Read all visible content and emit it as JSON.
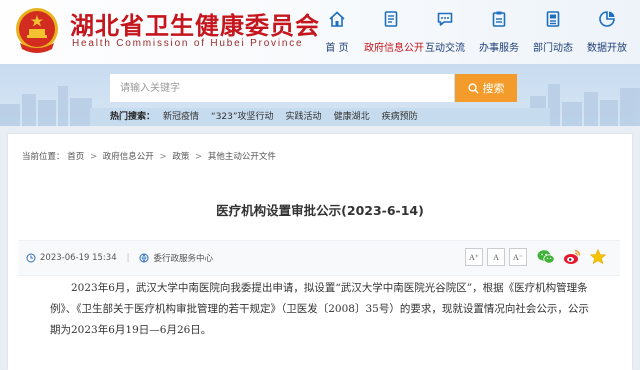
{
  "site": {
    "title": "湖北省卫生健康委员会",
    "subtitle": "Health Commission of Hubei Province"
  },
  "nav": [
    {
      "label": "首  页",
      "icon": "home-icon",
      "active": false
    },
    {
      "label": "政府信息公开",
      "icon": "document-icon",
      "active": true
    },
    {
      "label": "互动交流",
      "icon": "chat-icon",
      "active": false
    },
    {
      "label": "办事服务",
      "icon": "clipboard-icon",
      "active": false
    },
    {
      "label": "部门动态",
      "icon": "news-icon",
      "active": false
    },
    {
      "label": "数据开放",
      "icon": "data-icon",
      "active": false
    }
  ],
  "search": {
    "placeholder": "请输入关键字",
    "button_label": "搜索"
  },
  "hot_words": {
    "label": "热门搜索：",
    "items": [
      "新冠疫情",
      "“323”攻坚行动",
      "实践活动",
      "健康湖北",
      "疾病预防"
    ]
  },
  "breadcrumb": {
    "prefix": "当前位置：",
    "items": [
      "首页",
      "政府信息公开",
      "政策",
      "其他主动公开文件"
    ]
  },
  "article": {
    "title": "医疗机构设置审批公示(2023-6-14)",
    "date": "2023-06-19 15:34",
    "source": "委行政服务中心",
    "font_sizes": [
      "A⁺",
      "A",
      "A⁻"
    ],
    "body": "2023年6月，武汉大学中南医院向我委提出申请，拟设置“武汉大学中南医院光谷院区”，根据《医疗机构管理条例》、《卫生部关于医疗机构审批管理的若干规定》（卫医发〔2008〕35号）的要求，现就设置情况向社会公示，公示期为2023年6月19日—6月26日。"
  },
  "share": [
    "wechat-icon",
    "weibo-icon",
    "favorite-star-icon"
  ],
  "colors": {
    "brand_red": "#c4161c",
    "nav_blue": "#1f3e78",
    "search_orange": "#f39c2b",
    "accent_blue": "#2f6fba"
  }
}
